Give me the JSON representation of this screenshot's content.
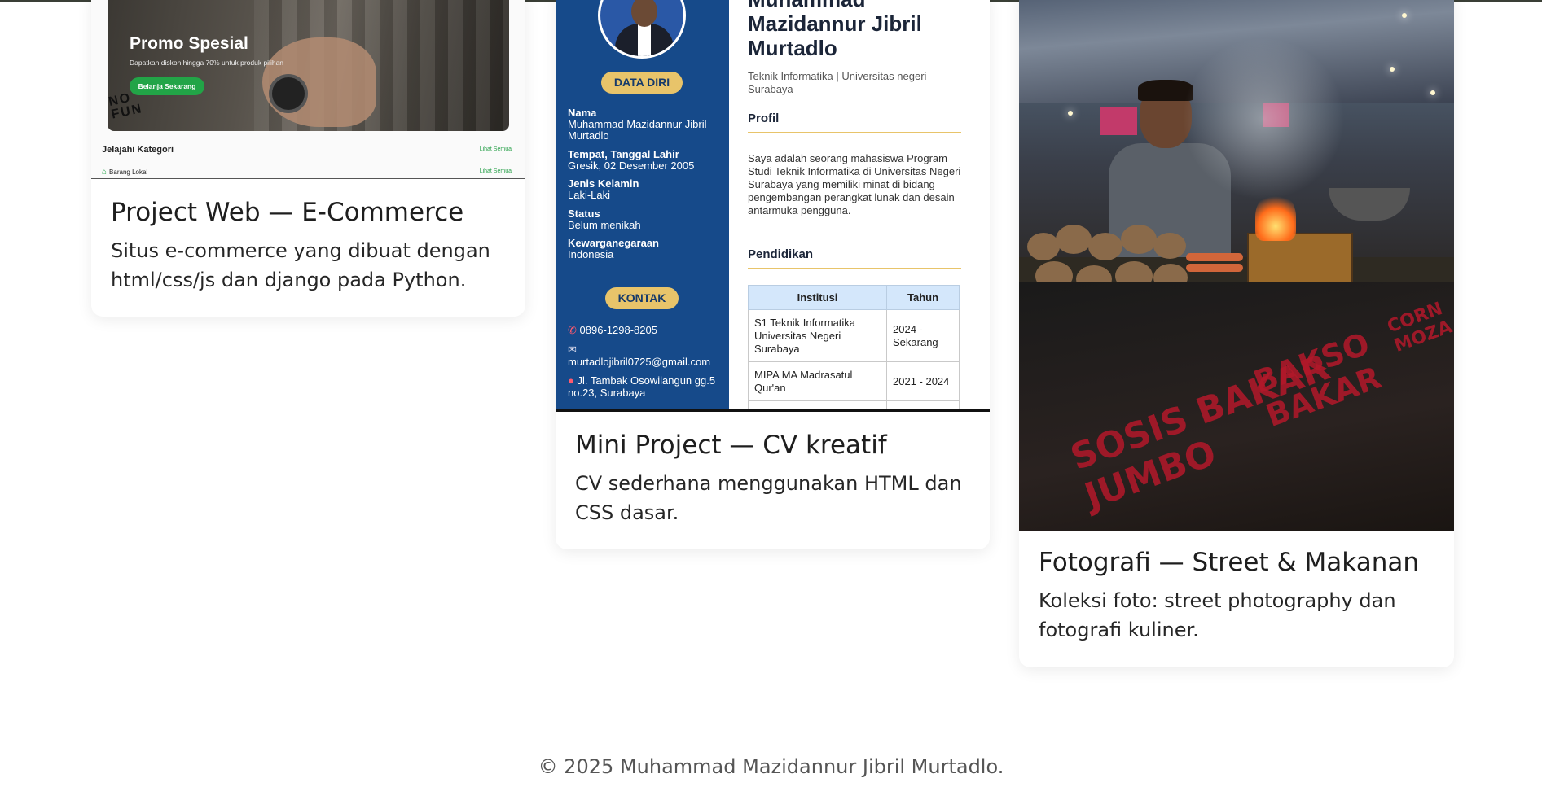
{
  "projects": [
    {
      "title": "Project Web — E-Commerce",
      "description": "Situs e-commerce yang dibuat dengan html/css/js dan django pada Python.",
      "thumbnail": {
        "promo_title": "Promo Spesial",
        "promo_subtitle": "Dapatkan diskon hingga 70% untuk produk pilihan",
        "promo_button": "Belanja Sekarang",
        "stamp": "NO FUN",
        "category_heading": "Jelajahi Kategori",
        "see_all": "Lihat Semua",
        "category_item": "Barang Lokal",
        "see_all_2": "Lihat Semua"
      }
    },
    {
      "title": "Mini Project — CV kreatif",
      "description": "CV sederhana menggunakan HTML dan CSS dasar.",
      "thumbnail": {
        "name": "Muhammad Mazidannur Jibril Murtadlo",
        "role": "Teknik Informatika | Universitas negeri Surabaya",
        "data_diri_label": "DATA DIRI",
        "fields": [
          {
            "label": "Nama",
            "value": "Muhammad Mazidannur Jibril Murtadlo"
          },
          {
            "label": "Tempat, Tanggal Lahir",
            "value": "Gresik, 02 Desember 2005"
          },
          {
            "label": "Jenis Kelamin",
            "value": "Laki-Laki"
          },
          {
            "label": "Status",
            "value": "Belum menikah"
          },
          {
            "label": "Kewarganegaraan",
            "value": "Indonesia"
          }
        ],
        "kontak_label": "KONTAK",
        "phone": "0896-1298-8205",
        "email": "murtadlojibril0725@gmail.com",
        "address": "Jl. Tambak Osowilangun gg.5 no.23, Surabaya",
        "profil_heading": "Profil",
        "profil_text": "Saya adalah seorang mahasiswa Program Studi Teknik Informatika di Universitas Negeri Surabaya yang memiliki minat di bidang pengembangan perangkat lunak dan desain antarmuka pengguna.",
        "pendidikan_heading": "Pendidikan",
        "table_headers": [
          "Institusi",
          "Tahun"
        ],
        "table_rows": [
          [
            "S1 Teknik Informatika Universitas Negeri Surabaya",
            "2024 - Sekarang"
          ],
          [
            "MIPA MA Madrasatul Qur'an",
            "2021 - 2024"
          ]
        ]
      }
    },
    {
      "title": "Fotografi — Street & Makanan",
      "description": "Koleksi foto: street photography dan fotografi kuliner.",
      "thumbnail": {
        "sign_text_1": "SOSIS BAKAR JUMBO",
        "sign_text_2": "BAKSO BAKAR",
        "sign_text_3": "CORN MOZA"
      }
    }
  ],
  "footer": {
    "copyright": "© 2025 Muhammad Mazidannur Jibril Murtadlo."
  }
}
